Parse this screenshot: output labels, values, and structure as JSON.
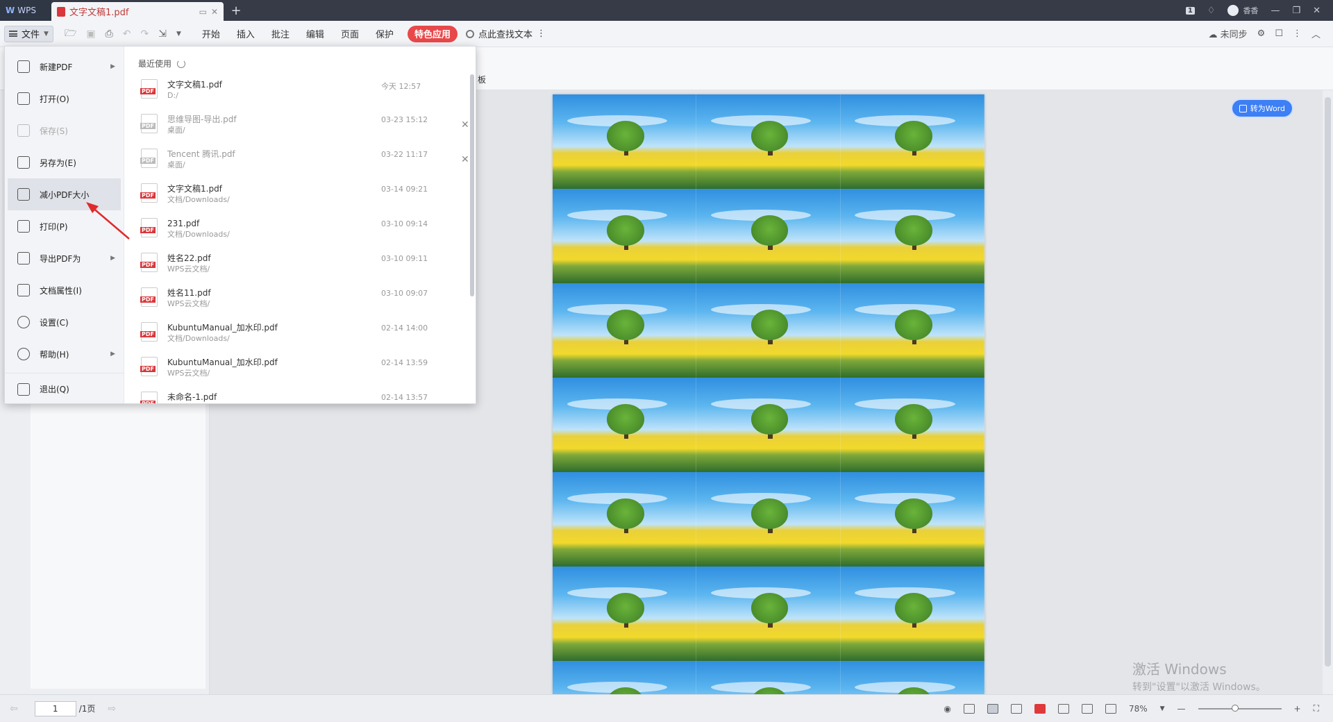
{
  "titlebar": {
    "app_name": "WPS",
    "tab_name": "文字文稿1.pdf",
    "user": "香香"
  },
  "toolbar": {
    "file_label": "文件",
    "tabs": [
      "开始",
      "插入",
      "批注",
      "编辑",
      "页面",
      "保护"
    ],
    "feature_tab": "特色应用",
    "search_label": "点此查找文本",
    "sync_label": "未同步"
  },
  "subbar": {
    "fragment": "板"
  },
  "file_menu": {
    "items": [
      {
        "label": "新建PDF",
        "has_submenu": true,
        "disabled": false,
        "active": false
      },
      {
        "label": "打开(O)",
        "has_submenu": false,
        "disabled": false,
        "active": false
      },
      {
        "label": "保存(S)",
        "has_submenu": false,
        "disabled": true,
        "active": false
      },
      {
        "label": "另存为(E)",
        "has_submenu": false,
        "disabled": false,
        "active": false
      },
      {
        "label": "减小PDF大小",
        "has_submenu": false,
        "disabled": false,
        "active": true
      },
      {
        "label": "打印(P)",
        "has_submenu": false,
        "disabled": false,
        "active": false
      },
      {
        "label": "导出PDF为",
        "has_submenu": true,
        "disabled": false,
        "active": false
      },
      {
        "label": "文档属性(I)",
        "has_submenu": false,
        "disabled": false,
        "active": false
      },
      {
        "label": "设置(C)",
        "has_submenu": false,
        "disabled": false,
        "active": false
      },
      {
        "label": "帮助(H)",
        "has_submenu": true,
        "disabled": false,
        "active": false
      },
      {
        "label": "退出(Q)",
        "has_submenu": false,
        "disabled": false,
        "active": false
      }
    ],
    "recent_title": "最近使用",
    "recent_files": [
      {
        "name": "文字文稿1.pdf",
        "path": "D:/",
        "time": "今天 12:57",
        "dim": false,
        "closable": false
      },
      {
        "name": "思维导图-导出.pdf",
        "path": "桌面/",
        "time": "03-23 15:12",
        "dim": true,
        "closable": true
      },
      {
        "name": "Tencent 腾讯.pdf",
        "path": "桌面/",
        "time": "03-22 11:17",
        "dim": true,
        "closable": true
      },
      {
        "name": "文字文稿1.pdf",
        "path": "文档/Downloads/",
        "time": "03-14 09:21",
        "dim": false,
        "closable": false
      },
      {
        "name": "231.pdf",
        "path": "文档/Downloads/",
        "time": "03-10 09:14",
        "dim": false,
        "closable": false
      },
      {
        "name": "姓名22.pdf",
        "path": "WPS云文档/",
        "time": "03-10 09:11",
        "dim": false,
        "closable": false
      },
      {
        "name": "姓名11.pdf",
        "path": "WPS云文档/",
        "time": "03-10 09:07",
        "dim": false,
        "closable": false
      },
      {
        "name": "KubuntuManual_加水印.pdf",
        "path": "文档/Downloads/",
        "time": "02-14 14:00",
        "dim": false,
        "closable": false
      },
      {
        "name": "KubuntuManual_加水印.pdf",
        "path": "WPS云文档/",
        "time": "02-14 13:59",
        "dim": false,
        "closable": false
      },
      {
        "name": "未命名-1.pdf",
        "path": "",
        "time": "02-14 13:57",
        "dim": false,
        "closable": false
      }
    ]
  },
  "document": {
    "to_word_label": "转为Word",
    "watermark_line1": "激活 Windows",
    "watermark_line2": "转到\"设置\"以激活 Windows。"
  },
  "statusbar": {
    "page_current": "1",
    "page_total": "/1页",
    "zoom": "78%"
  },
  "colors": {
    "accent_red": "#e8484a",
    "titlebar": "#373b47",
    "word_blue": "#3d7ff5"
  }
}
